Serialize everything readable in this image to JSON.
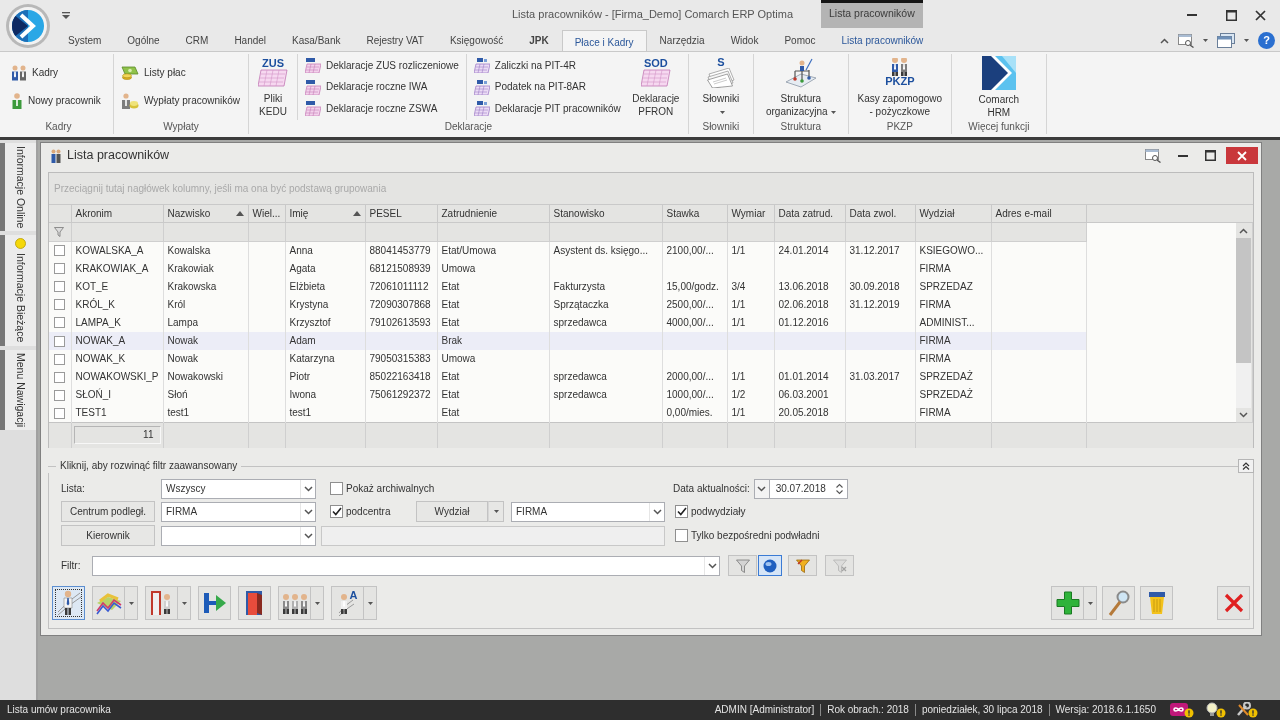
{
  "title_bar": {
    "title": "Lista pracowników - [Firma_Demo] Comarch ERP Optima",
    "context_tab": "Lista pracowników"
  },
  "ribbon": {
    "tabs": [
      {
        "label": "System",
        "selected": false,
        "kind": "plain"
      },
      {
        "label": "Ogólne",
        "selected": false,
        "kind": "plain"
      },
      {
        "label": "CRM",
        "selected": false,
        "kind": "plain"
      },
      {
        "label": "Handel",
        "selected": false,
        "kind": "plain"
      },
      {
        "label": "Kasa/Bank",
        "selected": false,
        "kind": "plain"
      },
      {
        "label": "Rejestry VAT",
        "selected": false,
        "kind": "plain"
      },
      {
        "label": "Księgowość",
        "selected": false,
        "kind": "plain"
      },
      {
        "label": "JPK",
        "selected": false,
        "kind": "bold"
      },
      {
        "label": "Płace i Kadry",
        "selected": true,
        "kind": "plain"
      },
      {
        "label": "Narzędzia",
        "selected": false,
        "kind": "plain"
      },
      {
        "label": "Widok",
        "selected": false,
        "kind": "plain"
      },
      {
        "label": "Pomoc",
        "selected": false,
        "kind": "plain"
      },
      {
        "label": "Lista pracowników",
        "selected": false,
        "kind": "context"
      }
    ],
    "help": "?",
    "groups": [
      {
        "label": "Kadry",
        "controls": [
          {
            "kind": "stack",
            "items": [
              {
                "label": "Kadry"
              },
              {
                "label": "Nowy pracownik"
              }
            ]
          }
        ]
      },
      {
        "label": "Wypłaty",
        "controls": [
          {
            "kind": "stack",
            "items": [
              {
                "label": "Listy płac"
              },
              {
                "label": "Wypłaty pracowników"
              }
            ]
          }
        ]
      },
      {
        "label": "Deklaracje",
        "controls": [
          {
            "kind": "large",
            "label": "Pliki KEDU",
            "badge": "ZUS",
            "menu": false
          },
          {
            "kind": "stack",
            "items": [
              {
                "label": "Deklaracje ZUS rozliczeniowe"
              },
              {
                "label": "Deklaracje roczne IWA"
              },
              {
                "label": "Deklaracje roczne ZSWA"
              }
            ]
          },
          {
            "kind": "stack",
            "items": [
              {
                "label": "Zaliczki na PIT-4R"
              },
              {
                "label": "Podatek na PIT-8AR"
              },
              {
                "label": "Deklaracje PIT pracowników"
              }
            ]
          },
          {
            "kind": "large",
            "label": "Deklaracje PFRON",
            "badge": "SOD",
            "menu": false
          }
        ]
      },
      {
        "label": "Słowniki",
        "controls": [
          {
            "kind": "large",
            "label": "Słowniki",
            "badge": "S",
            "menu": true
          }
        ]
      },
      {
        "label": "Struktura",
        "controls": [
          {
            "kind": "large",
            "label": "Struktura organizacyjna",
            "menu": true
          }
        ]
      },
      {
        "label": "PKZP",
        "controls": [
          {
            "kind": "large",
            "label": "Kasy zapomogowo - pożyczkowe",
            "badge": "PKZP",
            "menu": false
          }
        ]
      },
      {
        "label": "Więcej funkcji",
        "controls": [
          {
            "kind": "large",
            "label": "Comarch HRM",
            "menu": false
          }
        ]
      }
    ]
  },
  "sidebar": [
    {
      "label": "Informacje Online",
      "alert": false
    },
    {
      "label": "Informacje Bieżące",
      "alert": true
    },
    {
      "label": "Menu Nawigacji",
      "alert": false
    }
  ],
  "window": {
    "title": "Lista pracowników",
    "group_hint": "Przeciągnij tutaj nagłówek kolumny, jeśli ma ona być podstawą grupowania"
  },
  "grid": {
    "columns": [
      {
        "label": "Akronim",
        "sorted": false
      },
      {
        "label": "Nazwisko",
        "sorted": true
      },
      {
        "label": "Wiel...",
        "sorted": false
      },
      {
        "label": "Imię",
        "sorted": true
      },
      {
        "label": "PESEL",
        "sorted": false
      },
      {
        "label": "Zatrudnienie",
        "sorted": false
      },
      {
        "label": "Stanowisko",
        "sorted": false
      },
      {
        "label": "Stawka",
        "sorted": false
      },
      {
        "label": "Wymiar",
        "sorted": false
      },
      {
        "label": "Data zatrud.",
        "sorted": false
      },
      {
        "label": "Data zwol.",
        "sorted": false
      },
      {
        "label": "Wydział",
        "sorted": false
      },
      {
        "label": "Adres e-mail",
        "sorted": false
      }
    ],
    "rows": [
      {
        "checked": false,
        "selected": false,
        "cells": [
          "KOWALSKA_A",
          "Kowalska",
          null,
          "Anna",
          "88041453779",
          "Etat/Umowa",
          "Asystent ds. księgo...",
          "2100,00/...",
          "1/1",
          "24.01.2014",
          "31.12.2017",
          "KSIEGOWO...",
          null
        ]
      },
      {
        "checked": false,
        "selected": false,
        "cells": [
          "KRAKOWIAK_A",
          "Krakowiak",
          null,
          "Agata",
          "68121508939",
          "Umowa",
          null,
          null,
          null,
          null,
          null,
          "FIRMA",
          null
        ]
      },
      {
        "checked": false,
        "selected": false,
        "cells": [
          "KOT_E",
          "Krakowska",
          null,
          "Elżbieta",
          "72061011112",
          "Etat",
          "Fakturzysta",
          "15,00/godz.",
          "3/4",
          "13.06.2018",
          "30.09.2018",
          "SPRZEDAZ",
          null
        ]
      },
      {
        "checked": false,
        "selected": false,
        "cells": [
          "KRÓL_K",
          "Król",
          null,
          "Krystyna",
          "72090307868",
          "Etat",
          "Sprzątaczka",
          "2500,00/...",
          "1/1",
          "02.06.2018",
          "31.12.2019",
          "FIRMA",
          null
        ]
      },
      {
        "checked": false,
        "selected": false,
        "cells": [
          "LAMPA_K",
          "Lampa",
          null,
          "Krzysztof",
          "79102613593",
          "Etat",
          "sprzedawca",
          "4000,00/...",
          "1/1",
          "01.12.2016",
          null,
          "ADMINIST...",
          null
        ]
      },
      {
        "checked": false,
        "selected": true,
        "cells": [
          "NOWAK_A",
          "Nowak",
          null,
          "Adam",
          null,
          "Brak",
          null,
          null,
          null,
          null,
          null,
          "FIRMA",
          null
        ]
      },
      {
        "checked": false,
        "selected": false,
        "cells": [
          "NOWAK_K",
          "Nowak",
          null,
          "Katarzyna",
          "79050315383",
          "Umowa",
          null,
          null,
          null,
          null,
          null,
          "FIRMA",
          null
        ]
      },
      {
        "checked": false,
        "selected": false,
        "cells": [
          "NOWAKOWSKI_P",
          "Nowakowski",
          null,
          "Piotr",
          "85022163418",
          "Etat",
          "sprzedawca",
          "2000,00/...",
          "1/1",
          "01.01.2014",
          "31.03.2017",
          "SPRZEDAŻ",
          null
        ]
      },
      {
        "checked": false,
        "selected": false,
        "cells": [
          "SŁOŃ_I",
          "Słoń",
          null,
          "Iwona",
          "75061292372",
          "Etat",
          "sprzedawca",
          "1000,00/...",
          "1/2",
          "06.03.2001",
          null,
          "SPRZEDAŻ",
          null
        ]
      },
      {
        "checked": false,
        "selected": false,
        "cells": [
          "TEST1",
          "test1",
          null,
          "test1",
          null,
          "Etat",
          null,
          "0,00/mies.",
          "1/1",
          "20.05.2018",
          null,
          "FIRMA",
          null
        ]
      }
    ],
    "footer_count": "11"
  },
  "filter_panel": {
    "legend": "Kliknij, aby rozwinąć filtr zaawansowany",
    "list_label": "Lista:",
    "list_value": "Wszyscy",
    "archived": {
      "label": "Pokaż archiwalnych",
      "checked": false
    },
    "date_label": "Data aktualności:",
    "date_value": "30.07.2018",
    "center_button": "Centrum podległ.",
    "center_value": "FIRMA",
    "subcenters": {
      "label": "podcentra",
      "checked": true
    },
    "department_button": "Wydział",
    "department_value": "FIRMA",
    "subdepartments": {
      "label": "podwydziały",
      "checked": true
    },
    "manager_button": "Kierownik",
    "direct_only": {
      "label": "Tylko bezpośredni podwładni",
      "checked": false
    },
    "filter_label": "Filtr:",
    "filter_buttons": [
      {
        "on": false,
        "disabled": false
      },
      {
        "on": true,
        "disabled": false
      },
      {
        "on": false,
        "disabled": false
      },
      {
        "on": false,
        "disabled": true
      }
    ]
  },
  "toolbar": {
    "left": [
      {
        "menu": false,
        "focused": true
      },
      {
        "menu": true,
        "focused": false
      },
      {
        "menu": true,
        "focused": false
      },
      {
        "menu": false,
        "focused": false
      },
      {
        "menu": false,
        "focused": false
      },
      {
        "menu": true,
        "focused": false
      },
      {
        "menu": true,
        "focused": false,
        "icon_label": "A"
      }
    ],
    "right": [
      {
        "menu": true
      },
      {
        "menu": false
      },
      {
        "menu": false
      }
    ]
  },
  "status_bar": {
    "hint": "Lista umów pracownika",
    "segments": [
      "ADMIN [Administrator]",
      "Rok obrach.: 2018",
      "poniedziałek, 30 lipca 2018",
      "Wersja: 2018.6.1.1650"
    ]
  }
}
